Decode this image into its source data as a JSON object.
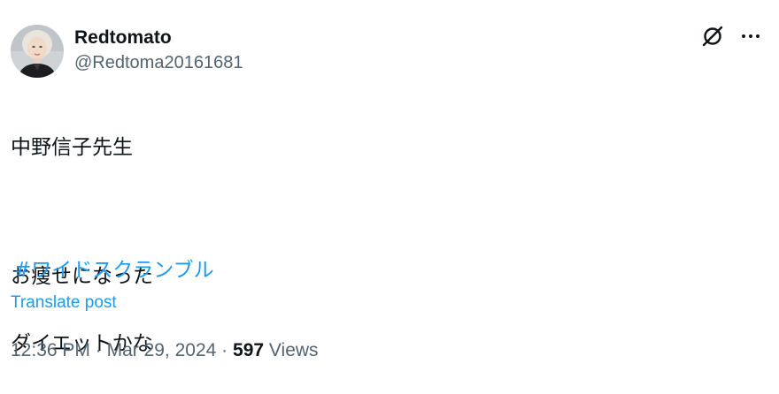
{
  "user": {
    "display_name": "Redtomato",
    "handle": "@Redtoma20161681"
  },
  "actions": {
    "grok_icon": "grok-slash-circle-icon",
    "more_icon": "more-horizontal-icon"
  },
  "post": {
    "lines": [
      "中野信子先生",
      "",
      "お痩せになった",
      "ダイエットかな"
    ],
    "hashtag": "#ワイドスクランブル",
    "translate_label": "Translate post"
  },
  "meta": {
    "time": "12:36 PM",
    "separator": "·",
    "date": "Mar 29, 2024",
    "views_count": "597",
    "views_label": "Views"
  },
  "colors": {
    "text": "#0f1419",
    "secondary": "#536471",
    "link": "#1d9bf0"
  }
}
